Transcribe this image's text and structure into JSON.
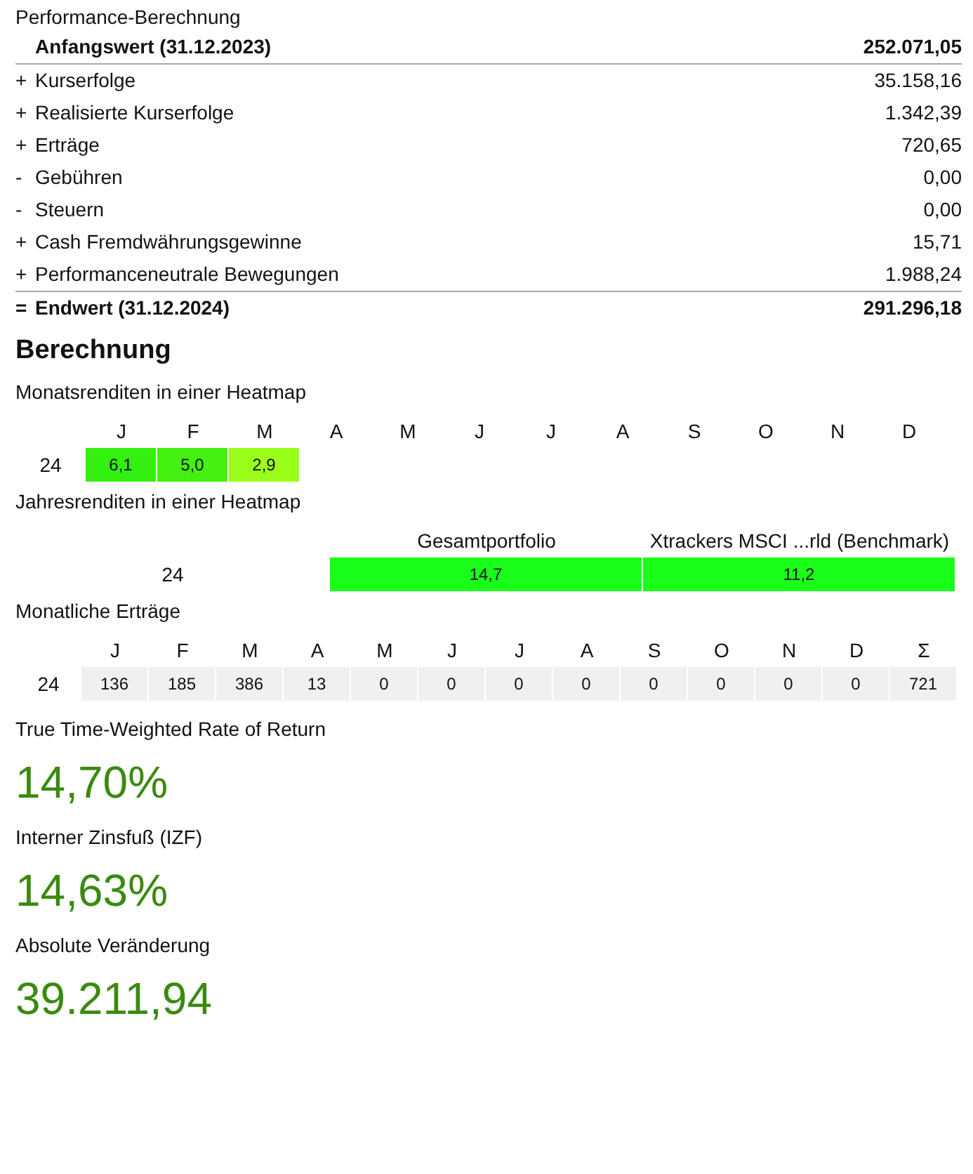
{
  "calculation": {
    "title": "Performance-Berechnung",
    "rows": [
      {
        "kind": "start",
        "label": "Anfangswert (31.12.2023)",
        "value": "252.071,05"
      },
      {
        "kind": "item",
        "sign": "+",
        "label": "Kurserfolge",
        "value": "35.158,16"
      },
      {
        "kind": "item",
        "sign": "+",
        "label": "Realisierte Kurserfolge",
        "value": "1.342,39"
      },
      {
        "kind": "item",
        "sign": "+",
        "label": "Erträge",
        "value": "720,65"
      },
      {
        "kind": "item",
        "sign": "-",
        "label": "Gebühren",
        "value": "0,00"
      },
      {
        "kind": "item",
        "sign": "-",
        "label": "Steuern",
        "value": "0,00"
      },
      {
        "kind": "item",
        "sign": "+",
        "label": "Cash Fremdwährungsgewinne",
        "value": "15,71"
      },
      {
        "kind": "item",
        "sign": "+",
        "label": "Performanceneutrale Bewegungen",
        "value": "1.988,24"
      },
      {
        "kind": "end",
        "sign": "=",
        "label": "Endwert (31.12.2024)",
        "value": "291.296,18"
      }
    ]
  },
  "section_title": "Berechnung",
  "monthly_heatmap": {
    "title": "Monatsrenditen in einer Heatmap",
    "months": [
      "J",
      "F",
      "M",
      "A",
      "M",
      "J",
      "J",
      "A",
      "S",
      "O",
      "N",
      "D"
    ],
    "rows": [
      {
        "year": "24",
        "cells": [
          {
            "value": "6,1",
            "color": "#33f011"
          },
          {
            "value": "5,0",
            "color": "#44f011"
          },
          {
            "value": "2,9",
            "color": "#99ff1a"
          }
        ]
      }
    ]
  },
  "annual_heatmap": {
    "title": "Jahresrenditen in einer Heatmap",
    "columns": [
      "Gesamtportfolio",
      "Xtrackers MSCI ...rld (Benchmark)"
    ],
    "rows": [
      {
        "year": "24",
        "cells": [
          {
            "value": "14,7",
            "color": "#1aff1a"
          },
          {
            "value": "11,2",
            "color": "#1aff1a"
          }
        ]
      }
    ]
  },
  "monthly_income": {
    "title": "Monatliche Erträge",
    "columns": [
      "J",
      "F",
      "M",
      "A",
      "M",
      "J",
      "J",
      "A",
      "S",
      "O",
      "N",
      "D",
      "Σ"
    ],
    "rows": [
      {
        "year": "24",
        "values": [
          "136",
          "185",
          "386",
          "13",
          "0",
          "0",
          "0",
          "0",
          "0",
          "0",
          "0",
          "0",
          "721"
        ]
      }
    ]
  },
  "metrics": [
    {
      "label": "True Time-Weighted Rate of Return",
      "value": "14,70%"
    },
    {
      "label": "Interner Zinsfuß (IZF)",
      "value": "14,63%"
    },
    {
      "label": "Absolute Veränderung",
      "value": "39.211,94"
    }
  ]
}
